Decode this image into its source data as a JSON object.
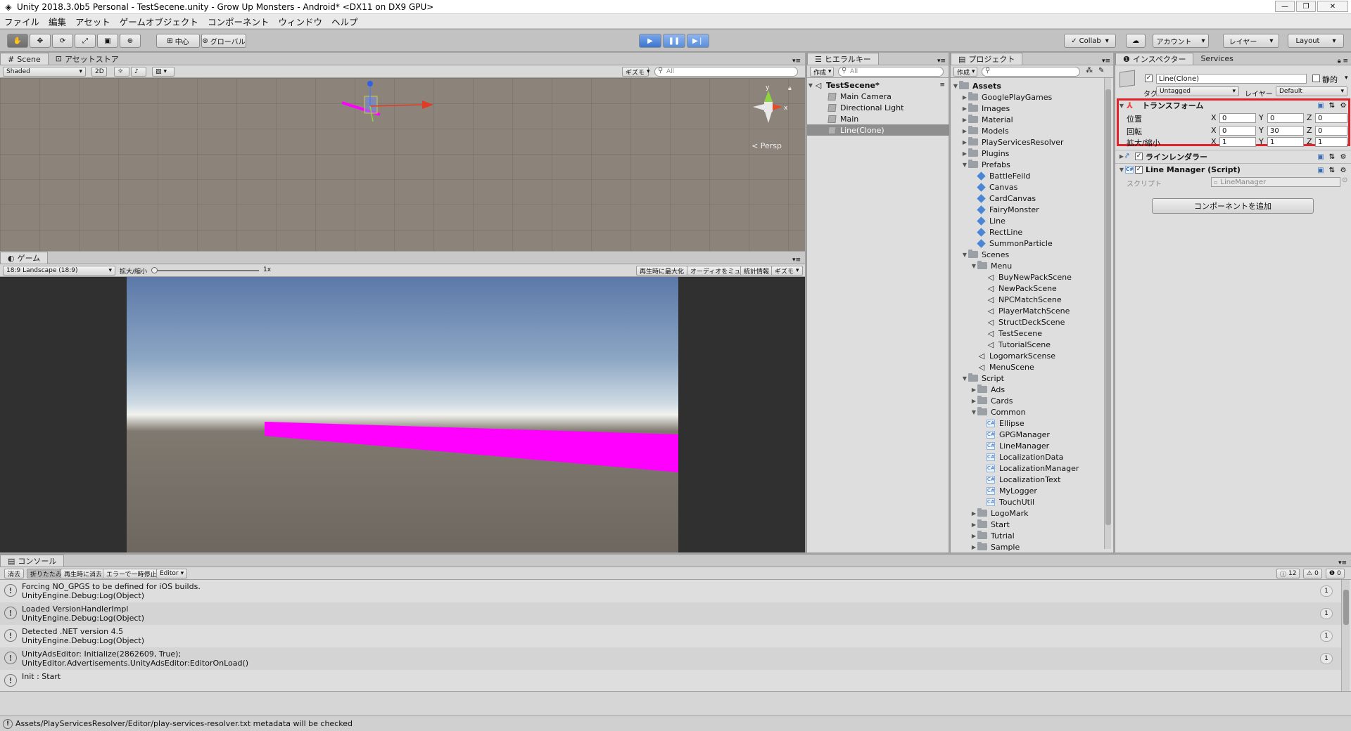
{
  "window": {
    "title": "Unity 2018.3.0b5 Personal - TestSecene.unity - Grow Up Monsters - Android* <DX11 on DX9 GPU>"
  },
  "menu": [
    "ファイル",
    "編集",
    "アセット",
    "ゲームオブジェクト",
    "コンポーネント",
    "ウィンドウ",
    "ヘルプ"
  ],
  "toolbar": {
    "pivot": "中心",
    "space": "グローバル",
    "collab": "Collab",
    "account": "アカウント",
    "layers": "レイヤー",
    "layout": "Layout"
  },
  "scene": {
    "tab_scene": "Scene",
    "tab_store": "アセットストア",
    "shading": "Shaded",
    "mode2d": "2D",
    "gizmos": "ギズモ",
    "search_placeholder": "All",
    "persp_label": "< Persp",
    "axis_y": "y",
    "axis_x": "x"
  },
  "game": {
    "tab": "ゲーム",
    "aspect": "18:9 Landscape (18:9)",
    "scale_label": "拡大/縮小",
    "scale_value": "1x",
    "maximize": "再生時に最大化",
    "mute": "オーディオをミュート",
    "stats": "統計情報",
    "gizmos": "ギズモ"
  },
  "hierarchy": {
    "tab": "ヒエラルキー",
    "create": "作成",
    "search_placeholder": "All",
    "scene_name": "TestSecene*",
    "items": [
      "Main Camera",
      "Directional Light",
      "Main",
      "Line(Clone)"
    ],
    "selected_index": 3
  },
  "project": {
    "tab": "プロジェクト",
    "create": "作成",
    "tree": [
      {
        "label": "Assets",
        "depth": 0,
        "kind": "folder",
        "open": true,
        "bold": true
      },
      {
        "label": "GooglePlayGames",
        "depth": 1,
        "kind": "folder"
      },
      {
        "label": "Images",
        "depth": 1,
        "kind": "folder"
      },
      {
        "label": "Material",
        "depth": 1,
        "kind": "folder"
      },
      {
        "label": "Models",
        "depth": 1,
        "kind": "folder"
      },
      {
        "label": "PlayServicesResolver",
        "depth": 1,
        "kind": "folder"
      },
      {
        "label": "Plugins",
        "depth": 1,
        "kind": "folder"
      },
      {
        "label": "Prefabs",
        "depth": 1,
        "kind": "folder",
        "open": true
      },
      {
        "label": "BattleFeild",
        "depth": 2,
        "kind": "prefab"
      },
      {
        "label": "Canvas",
        "depth": 2,
        "kind": "prefab"
      },
      {
        "label": "CardCanvas",
        "depth": 2,
        "kind": "prefab"
      },
      {
        "label": "FairyMonster",
        "depth": 2,
        "kind": "prefab"
      },
      {
        "label": "Line",
        "depth": 2,
        "kind": "prefab"
      },
      {
        "label": "RectLine",
        "depth": 2,
        "kind": "prefab"
      },
      {
        "label": "SummonParticle",
        "depth": 2,
        "kind": "prefab"
      },
      {
        "label": "Scenes",
        "depth": 1,
        "kind": "folder",
        "open": true
      },
      {
        "label": "Menu",
        "depth": 2,
        "kind": "folder",
        "open": true
      },
      {
        "label": "BuyNewPackScene",
        "depth": 3,
        "kind": "scene"
      },
      {
        "label": "NewPackScene",
        "depth": 3,
        "kind": "scene"
      },
      {
        "label": "NPCMatchScene",
        "depth": 3,
        "kind": "scene"
      },
      {
        "label": "PlayerMatchScene",
        "depth": 3,
        "kind": "scene"
      },
      {
        "label": "StructDeckScene",
        "depth": 3,
        "kind": "scene"
      },
      {
        "label": "TestSecene",
        "depth": 3,
        "kind": "scene"
      },
      {
        "label": "TutorialScene",
        "depth": 3,
        "kind": "scene"
      },
      {
        "label": "LogomarkScense",
        "depth": 2,
        "kind": "scene"
      },
      {
        "label": "MenuScene",
        "depth": 2,
        "kind": "scene"
      },
      {
        "label": "Script",
        "depth": 1,
        "kind": "folder",
        "open": true
      },
      {
        "label": "Ads",
        "depth": 2,
        "kind": "folder"
      },
      {
        "label": "Cards",
        "depth": 2,
        "kind": "folder"
      },
      {
        "label": "Common",
        "depth": 2,
        "kind": "folder",
        "open": true
      },
      {
        "label": "Ellipse",
        "depth": 3,
        "kind": "script"
      },
      {
        "label": "GPGManager",
        "depth": 3,
        "kind": "script"
      },
      {
        "label": "LineManager",
        "depth": 3,
        "kind": "script"
      },
      {
        "label": "LocalizationData",
        "depth": 3,
        "kind": "script"
      },
      {
        "label": "LocalizationManager",
        "depth": 3,
        "kind": "script"
      },
      {
        "label": "LocalizationText",
        "depth": 3,
        "kind": "script"
      },
      {
        "label": "MyLogger",
        "depth": 3,
        "kind": "script"
      },
      {
        "label": "TouchUtil",
        "depth": 3,
        "kind": "script"
      },
      {
        "label": "LogoMark",
        "depth": 2,
        "kind": "folder"
      },
      {
        "label": "Start",
        "depth": 2,
        "kind": "folder"
      },
      {
        "label": "Tutrial",
        "depth": 2,
        "kind": "folder"
      },
      {
        "label": "Sample",
        "depth": 2,
        "kind": "folder"
      }
    ]
  },
  "inspector": {
    "tab": "インスペクター",
    "tab_services": "Services",
    "object_name": "Line(Clone)",
    "static_label": "静的",
    "tag_label": "タグ",
    "tag_value": "Untagged",
    "layer_label": "レイヤー",
    "layer_value": "Default",
    "transform_title": "トランスフォーム",
    "position_label": "位置",
    "rotation_label": "回転",
    "scale_label": "拡大/縮小",
    "position": {
      "x": "0",
      "y": "0",
      "z": "0"
    },
    "rotation": {
      "x": "0",
      "y": "30",
      "z": "0"
    },
    "scale": {
      "x": "1",
      "y": "1",
      "z": "1"
    },
    "line_renderer_title": "ラインレンダラー",
    "line_manager_title": "Line Manager (Script)",
    "script_label": "スクリプト",
    "script_value": "LineManager",
    "add_component": "コンポーネントを追加",
    "highlight_color": "#e0222a"
  },
  "console": {
    "tab": "コンソール",
    "clear": "消去",
    "collapse": "折りたたみ",
    "clear_on_play": "再生時に消去",
    "error_pause": "エラーで一時停止",
    "editor": "Editor",
    "count_log": "12",
    "count_warn": "0",
    "count_error": "0",
    "logs": [
      {
        "line1": "Forcing NO_GPGS to be defined for iOS builds.",
        "line2": "UnityEngine.Debug:Log(Object)",
        "count": "1"
      },
      {
        "line1": "Loaded VersionHandlerImpl",
        "line2": "UnityEngine.Debug:Log(Object)",
        "count": "1"
      },
      {
        "line1": "Detected .NET version 4.5",
        "line2": "UnityEngine.Debug:Log(Object)",
        "count": "1"
      },
      {
        "line1": "UnityAdsEditor: Initialize(2862609, True);",
        "line2": "UnityEditor.Advertisements.UnityAdsEditor:EditorOnLoad()",
        "count": "1"
      },
      {
        "line1": "Init : Start",
        "line2": "",
        "count": ""
      }
    ]
  },
  "status": {
    "message": "Assets/PlayServicesResolver/Editor/play-services-resolver.txt metadata will be checked"
  },
  "colors": {
    "line_magenta": "#ff00ff",
    "play_blue": "#3b75cf"
  }
}
